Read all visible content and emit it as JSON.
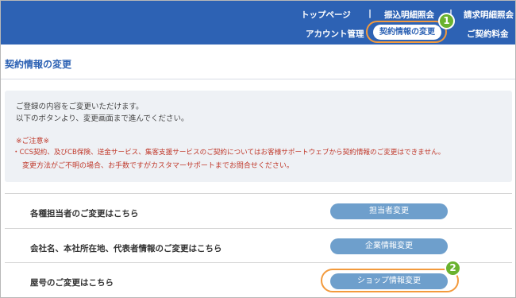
{
  "header": {
    "nav_top": [
      "トップページ",
      "振込明細照会",
      "請求明細照会"
    ],
    "separator": "|",
    "nav_bottom": [
      "アカウント管理",
      "契約情報の変更",
      "ご契約料金"
    ]
  },
  "callouts": [
    "1",
    "2"
  ],
  "page": {
    "title": "契約情報の変更",
    "info_lines": [
      "ご登録の内容をご変更いただけます。",
      "以下のボタンより、変更画面まで進んでください。"
    ],
    "warning_title": "※ご注意※",
    "warning_lines": [
      "・CCS契約、及びCB保険、送金サービス、集客支援サービスのご契約についてはお客様サポートウェブから契約情報のご変更はできません。",
      "変更方法がご不明の場合、お手数ですがカスタマーサポートまでお問合せください。"
    ]
  },
  "rows": [
    {
      "label": "各種担当者のご変更はこちら",
      "button": "担当者変更"
    },
    {
      "label": "会社名、本社所在地、代表者情報のご変更はこちら",
      "button": "企業情報変更"
    },
    {
      "label": "屋号のご変更はこちら",
      "button": "ショップ情報変更"
    }
  ],
  "colors": {
    "header_bg": "#2d62b4",
    "button_bg": "#6e9fcc",
    "callout": "#f39a3c",
    "badge": "#6ab22f",
    "warning": "#c0392b"
  }
}
